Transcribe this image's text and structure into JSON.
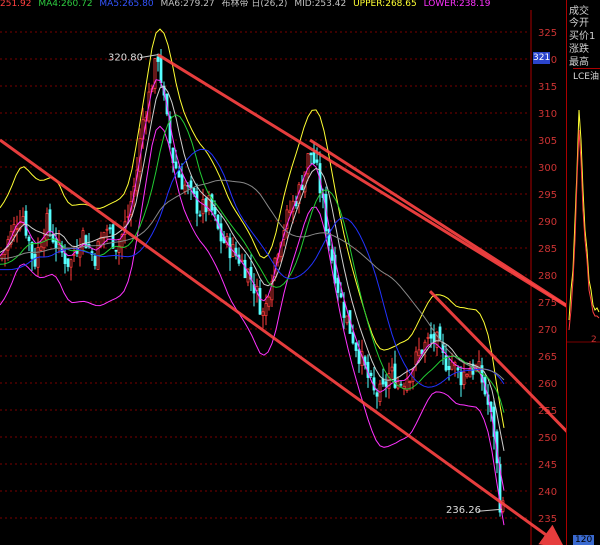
{
  "header": {
    "indicators": [
      {
        "text": "251.92",
        "color": "#ff4040"
      },
      {
        "text": "MA4:260.72",
        "color": "#2ecc40"
      },
      {
        "text": "MA5:265.80",
        "color": "#3355ff"
      },
      {
        "text": "MA6:279.27",
        "color": "#c0c0c0"
      },
      {
        "text": "布林带 日(26,2)",
        "color": "#c0c0c0"
      },
      {
        "text": "MID:253.42",
        "color": "#c0c0c0"
      },
      {
        "text": "UPPER:268.65",
        "color": "#ffff33"
      },
      {
        "text": "LOWER:238.19",
        "color": "#ff33ff"
      }
    ]
  },
  "side_panel": {
    "labels": [
      "成交",
      "今开",
      "买价1",
      "涨跌",
      "最高"
    ],
    "price_badge": "321",
    "panel_title": "LCE油",
    "bottom_value": "120",
    "right_tick": "2"
  },
  "chart_data": {
    "type": "candlestick",
    "ylim": [
      230,
      330
    ],
    "yticks": [
      235,
      240,
      245,
      250,
      255,
      260,
      265,
      270,
      275,
      280,
      285,
      290,
      295,
      300,
      305,
      310,
      315,
      320,
      325
    ],
    "annotations": [
      {
        "label": "320.80",
        "value": 320.8
      },
      {
        "label": "236.26",
        "value": 236.26
      }
    ],
    "colors": {
      "grid": "#7a0000",
      "axis_text": "#cc3333",
      "up": "#ff3b3b",
      "down": "#5ff",
      "boll_mid": "#cfcfcf",
      "boll_upper": "#ffff33",
      "boll_lower": "#ff33ff",
      "ma_green": "#22cc33",
      "ma_blue": "#2233ff",
      "ma_grey": "#888888",
      "trend": "#ff4444"
    }
  }
}
